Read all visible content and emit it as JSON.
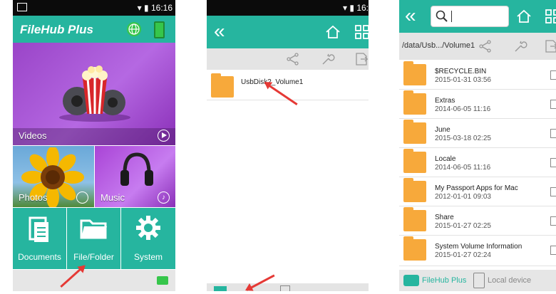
{
  "phone1": {
    "status_time": "16:16",
    "app_title": "FileHub Plus",
    "tiles": {
      "videos": "Videos",
      "photos": "Photos",
      "music": "Music",
      "documents": "Documents",
      "file_folder": "File/Folder",
      "system": "System"
    }
  },
  "phone2": {
    "status_time": "16:",
    "items": [
      {
        "name": "UsbDisk2_Volume1"
      }
    ]
  },
  "phone3": {
    "path": "/data/Usb.../Volume1",
    "items": [
      {
        "name": "$RECYCLE.BIN",
        "date": "2015-01-31 03:56"
      },
      {
        "name": "Extras",
        "date": "2014-06-05 11:16"
      },
      {
        "name": "June",
        "date": "2015-03-18 02:25"
      },
      {
        "name": "Locale",
        "date": "2014-06-05 11:16"
      },
      {
        "name": "My Passport Apps for Mac",
        "date": "2012-01-01 09:03"
      },
      {
        "name": "Share",
        "date": "2015-01-27 02:25"
      },
      {
        "name": "System Volume Information",
        "date": "2015-01-27 02:24"
      }
    ],
    "bottom_tabs": {
      "filehub_plus": "FileHub Plus",
      "local_device": "Local device"
    }
  },
  "colors": {
    "accent": "#26b59f",
    "folder": "#f7a93b",
    "arrow": "#e53935"
  }
}
